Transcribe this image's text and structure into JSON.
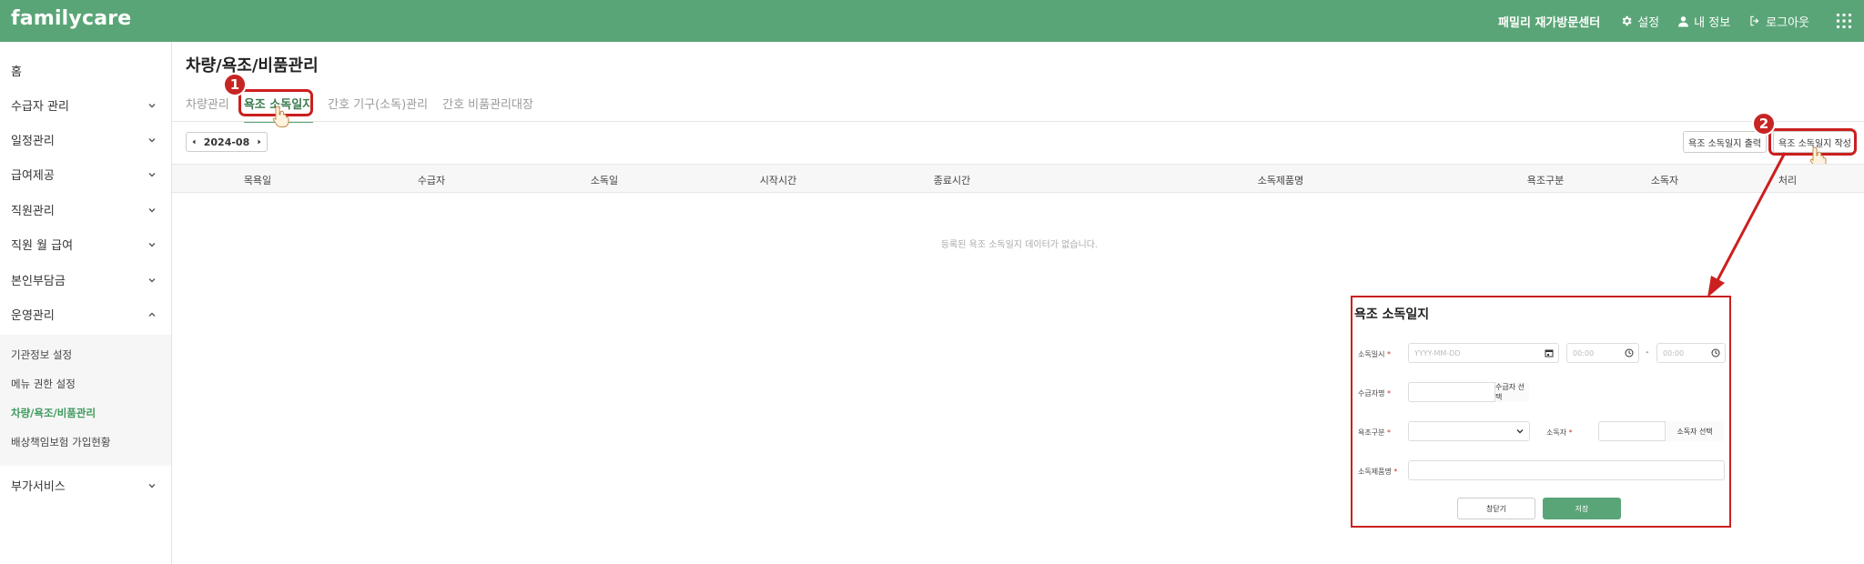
{
  "header": {
    "logo": "familycare",
    "center_name": "패밀리 재가방문센터",
    "settings_label": "설정",
    "my_info_label": "내 정보",
    "logout_label": "로그아웃"
  },
  "sidebar": {
    "items": [
      {
        "label": "홈"
      },
      {
        "label": "수급자 관리"
      },
      {
        "label": "일정관리"
      },
      {
        "label": "급여제공"
      },
      {
        "label": "직원관리"
      },
      {
        "label": "직원 월 급여"
      },
      {
        "label": "본인부담금"
      },
      {
        "label": "운영관리"
      },
      {
        "label": "부가서비스"
      }
    ],
    "sub_items": [
      {
        "label": "기관정보 설정"
      },
      {
        "label": "메뉴 권한 설정"
      },
      {
        "label": "차량/욕조/비품관리"
      },
      {
        "label": "배상책임보험 가입현황"
      }
    ]
  },
  "main": {
    "title": "차량/욕조/비품관리",
    "tabs": [
      {
        "label": "차량관리"
      },
      {
        "label": "욕조 소독일지"
      },
      {
        "label": "간호 기구(소독)관리"
      },
      {
        "label": "간호 비품관리대장"
      }
    ],
    "month": "2024-08",
    "print_button": "욕조 소독일지 출력",
    "write_button": "욕조 소독일지 작성",
    "columns": [
      "목욕일",
      "수급자",
      "소독일",
      "시작시간",
      "종료시간",
      "소독제품명",
      "욕조구분",
      "소독자",
      "처리"
    ],
    "empty_message": "등록된 욕조 소독일지 데이터가 없습니다."
  },
  "annotations": {
    "step1": "1",
    "step2": "2"
  },
  "popup": {
    "title": "욕조 소독일지",
    "date_label": "소독일시",
    "date_placeholder": "YYYY-MM-DD",
    "start_time_placeholder": "00:00",
    "dash": "-",
    "end_time_placeholder": "00:00",
    "recipient_label": "수급자명",
    "recipient_button": "수급자 선택",
    "tub_type_label": "욕조구분",
    "disinfector_label": "소독자",
    "disinfector_button": "소독자 선택",
    "product_label": "소독제품명",
    "required_mark": "*",
    "close_button": "창닫기",
    "save_button": "저장"
  },
  "colors": {
    "brand": "#5aa577",
    "active_text": "#3e9a5d",
    "annotation": "#cc1f1f"
  }
}
